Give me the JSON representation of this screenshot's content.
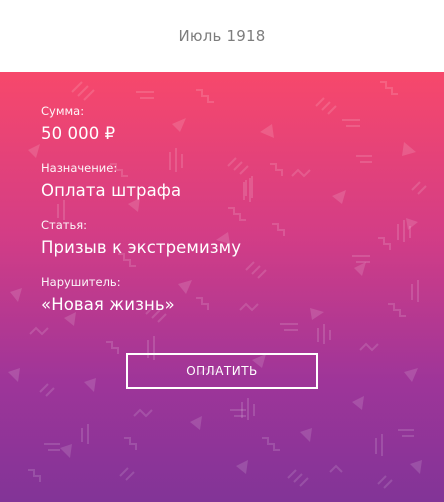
{
  "header": {
    "title": "Июль 1918"
  },
  "fine": {
    "amount_label": "Сумма:",
    "amount_value": "50 000 ₽",
    "purpose_label": "Назначение:",
    "purpose_value": "Оплата штрафа",
    "article_label": "Статья:",
    "article_value": "Призыв к экстремизму",
    "offender_label": "Нарушитель:",
    "offender_value": "«Новая жизнь»"
  },
  "actions": {
    "pay_label": "ОПЛАТИТЬ"
  },
  "colors": {
    "gradient_top": "#f7486b",
    "gradient_mid": "#d33d86",
    "gradient_bottom": "#823497",
    "title_text": "#7d7d7d"
  }
}
